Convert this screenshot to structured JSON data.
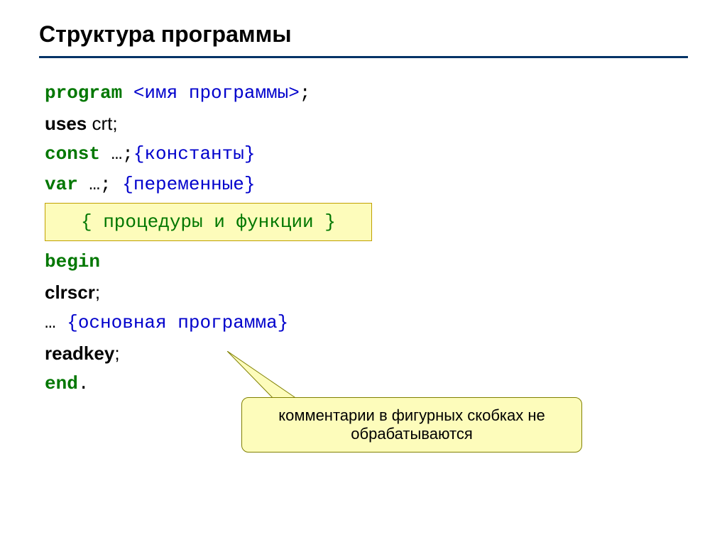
{
  "title": "Структура программы",
  "lines": {
    "l1_kw": "program",
    "l1_name": "<имя программы>",
    "l1_semi": ";",
    "l2_kw": "uses ",
    "l2_rest": "crt;",
    "l3_kw": "const",
    "l3_rest": " …;",
    "l3_comment": "{константы}",
    "l4_kw": "var",
    "l4_rest": " …; ",
    "l4_comment": "{переменные}",
    "highlight": "{ процедуры и функции }",
    "l5_kw": "begin",
    "l6_kw": "clrscr",
    "l6_rest": ";",
    "l7_pre": " … ",
    "l7_comment": "{основная программа}",
    "l8_kw": "readkey",
    "l8_rest": ";",
    "l9_kw": "end",
    "l9_rest": "."
  },
  "callout": "комментарии в фигурных скобках не обрабатываются"
}
